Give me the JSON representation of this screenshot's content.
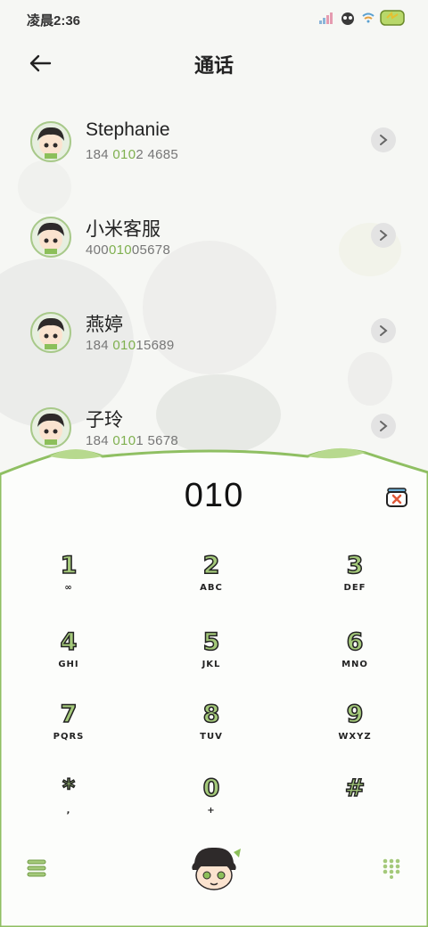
{
  "status_bar": {
    "time": "凌晨2:36",
    "icons": [
      "signal-icon",
      "sticker-icon",
      "wifi-icon",
      "battery-icon"
    ]
  },
  "header": {
    "title": "通话",
    "back_icon": "arrow-left-icon"
  },
  "contacts": [
    {
      "name": "Stephanie",
      "number_parts": [
        "184 ",
        "010",
        "2 4685"
      ]
    },
    {
      "name": "小米客服",
      "number_parts": [
        "400",
        "010",
        "05678"
      ]
    },
    {
      "name": "燕婷",
      "number_parts": [
        "184 ",
        "010",
        "15689"
      ]
    },
    {
      "name": "子玲",
      "number_parts": [
        "184 ",
        "010",
        "1 5678"
      ]
    }
  ],
  "dialer": {
    "input": "010",
    "keys": [
      {
        "digit": "1",
        "letters": "∞"
      },
      {
        "digit": "2",
        "letters": "ABC"
      },
      {
        "digit": "3",
        "letters": "DEF"
      },
      {
        "digit": "4",
        "letters": "GHI"
      },
      {
        "digit": "5",
        "letters": "JKL"
      },
      {
        "digit": "6",
        "letters": "MNO"
      },
      {
        "digit": "7",
        "letters": "PQRS"
      },
      {
        "digit": "8",
        "letters": "TUV"
      },
      {
        "digit": "9",
        "letters": "WXYZ"
      },
      {
        "digit": "*",
        "letters": ","
      },
      {
        "digit": "0",
        "letters": "+"
      },
      {
        "digit": "#",
        "letters": ""
      }
    ]
  },
  "colors": {
    "accent_green": "#a4c97a",
    "highlight_green": "#7fb04f",
    "text_dark": "#222222"
  }
}
